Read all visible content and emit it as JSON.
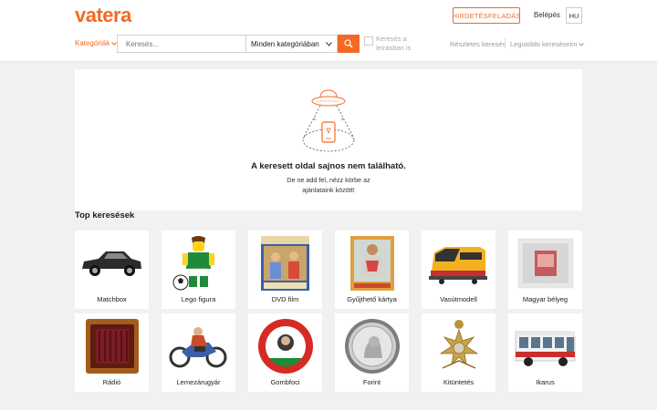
{
  "header": {
    "logo": "vatera",
    "ad_button": "HIRDETÉSFELADÁS",
    "login": "Belépés",
    "lang": "HU",
    "brand_color": "#f36b22"
  },
  "search": {
    "categories_link": "Kategóriák",
    "placeholder": "Keresés...",
    "category_select": "Minden kategóriában",
    "description_label": "Keresés a leírásban is",
    "advanced": "Részletes keresés",
    "recent": "Legutóbbi kereséseim"
  },
  "notfound": {
    "title": "A keresett oldal sajnos nem található.",
    "subtitle": "De ne add fel, nézz körbe az ajánlataink között!"
  },
  "top_searches": {
    "title": "Top keresések",
    "items": [
      {
        "label": "Matchbox",
        "icon": "car-icon"
      },
      {
        "label": "Lego figura",
        "icon": "lego-figure-icon"
      },
      {
        "label": "DVD film",
        "icon": "dvd-icon"
      },
      {
        "label": "Gyűjthető kártya",
        "icon": "card-icon"
      },
      {
        "label": "Vasútmodell",
        "icon": "train-icon"
      },
      {
        "label": "Magyar bélyeg",
        "icon": "stamp-icon"
      },
      {
        "label": "Rádió",
        "icon": "radio-icon"
      },
      {
        "label": "Lemezárugyár",
        "icon": "motorbike-toy-icon"
      },
      {
        "label": "Gombfoci",
        "icon": "button-football-icon"
      },
      {
        "label": "Forint",
        "icon": "coin-icon"
      },
      {
        "label": "Kitüntetés",
        "icon": "medal-icon"
      },
      {
        "label": "Ikarus",
        "icon": "bus-icon"
      }
    ]
  }
}
